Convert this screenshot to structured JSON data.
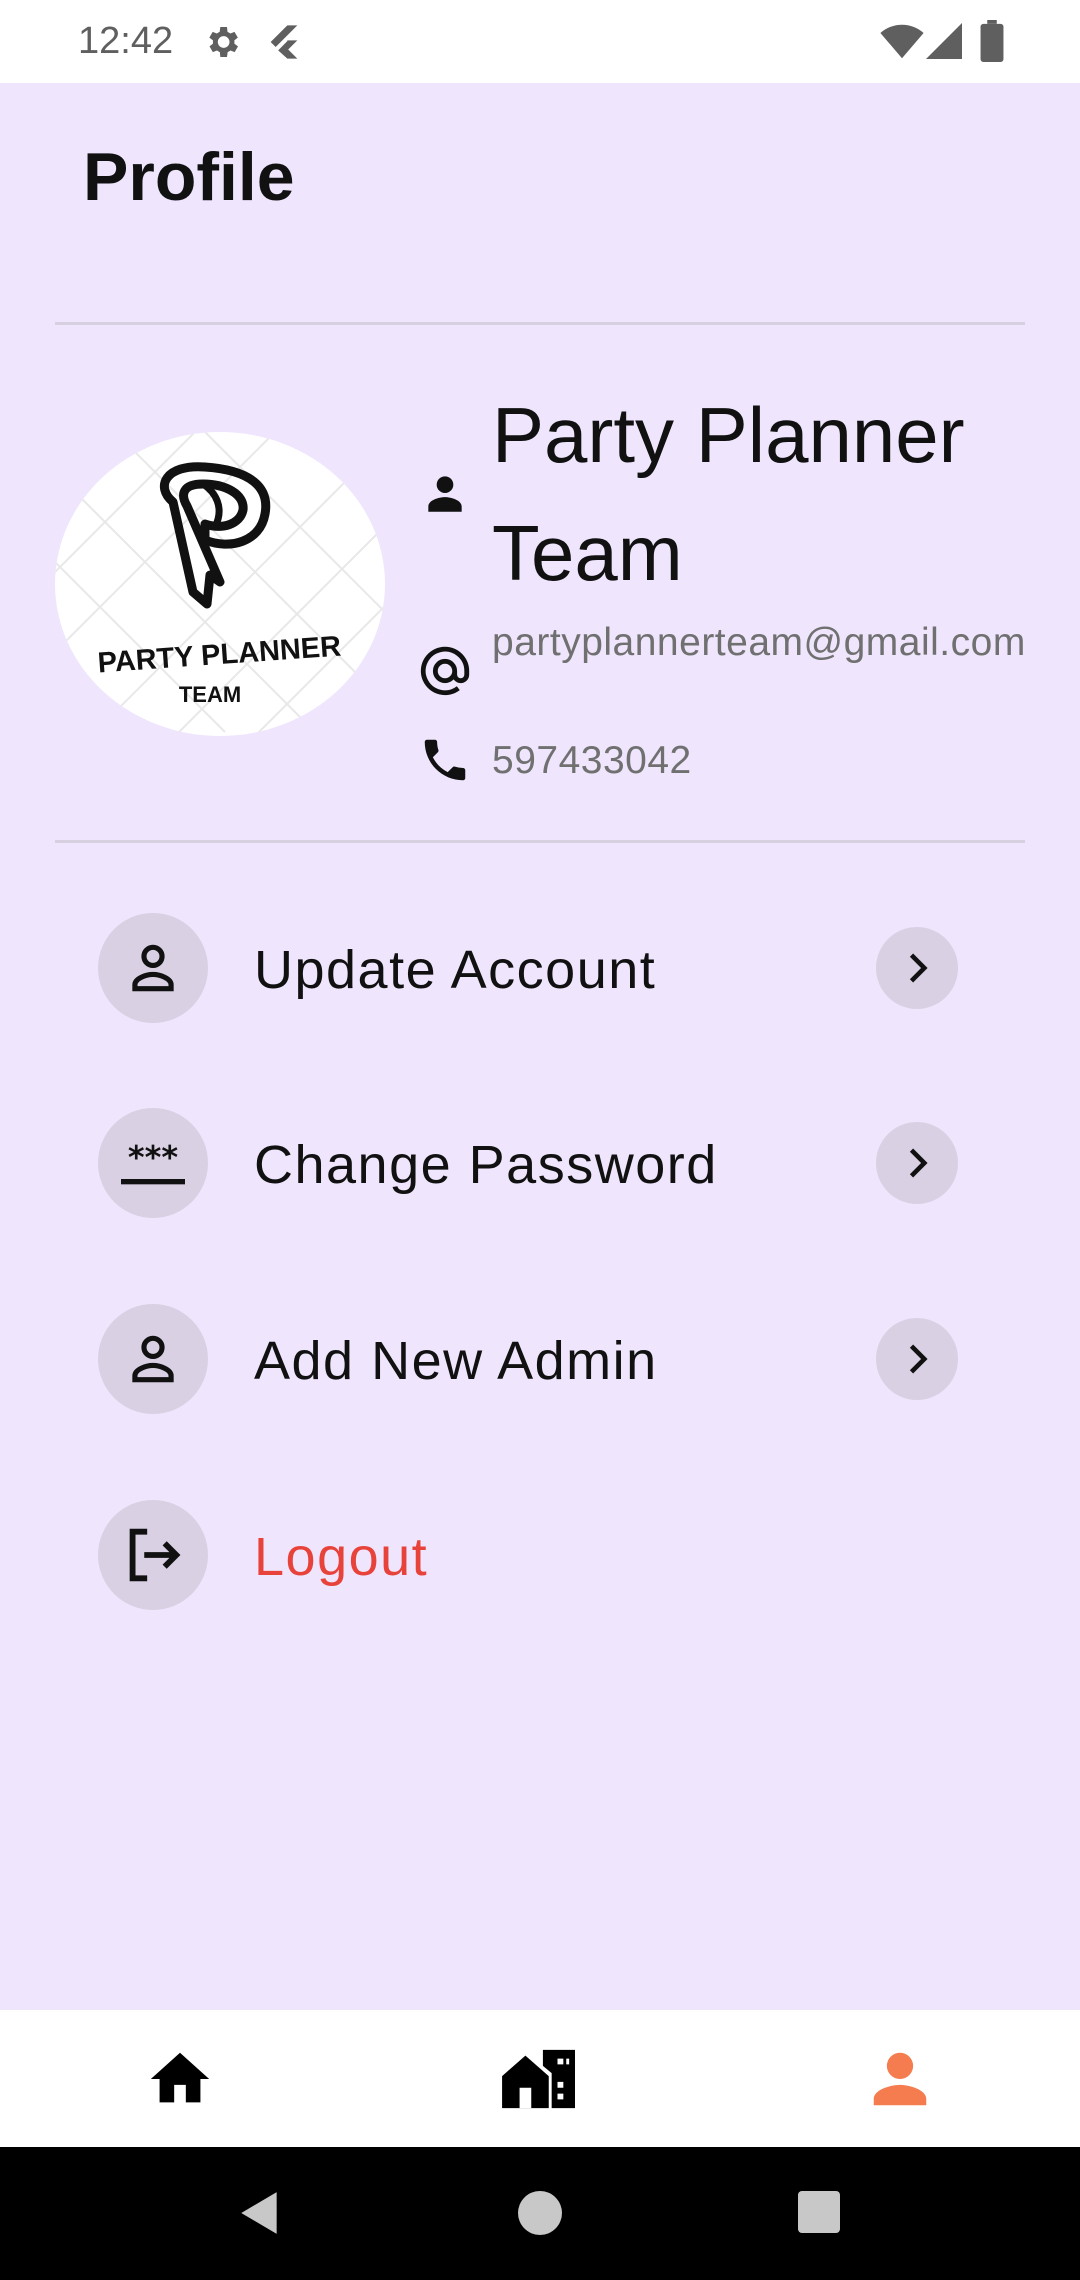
{
  "status_bar": {
    "time": "12:42"
  },
  "header": {
    "title": "Profile"
  },
  "profile": {
    "name": "Party Planner Team",
    "email": "partyplannerteam@gmail.com",
    "phone": "597433042",
    "logo_text_line1": "PARTY PLANNER",
    "logo_text_line2": "TEAM"
  },
  "menu": {
    "items": [
      {
        "label": "Update Account",
        "icon": "person-outline-icon"
      },
      {
        "label": "Change Password",
        "icon": "password-icon"
      },
      {
        "label": "Add New Admin",
        "icon": "person-outline-icon"
      },
      {
        "label": "Logout",
        "icon": "logout-icon"
      }
    ]
  },
  "bottom_nav": {
    "items": [
      "home-icon",
      "business-icon",
      "person-icon"
    ],
    "active_color": "#f57c4f"
  },
  "colors": {
    "background": "#efe5fd",
    "logout": "#e8433b",
    "circle": "#d9d0e3"
  }
}
